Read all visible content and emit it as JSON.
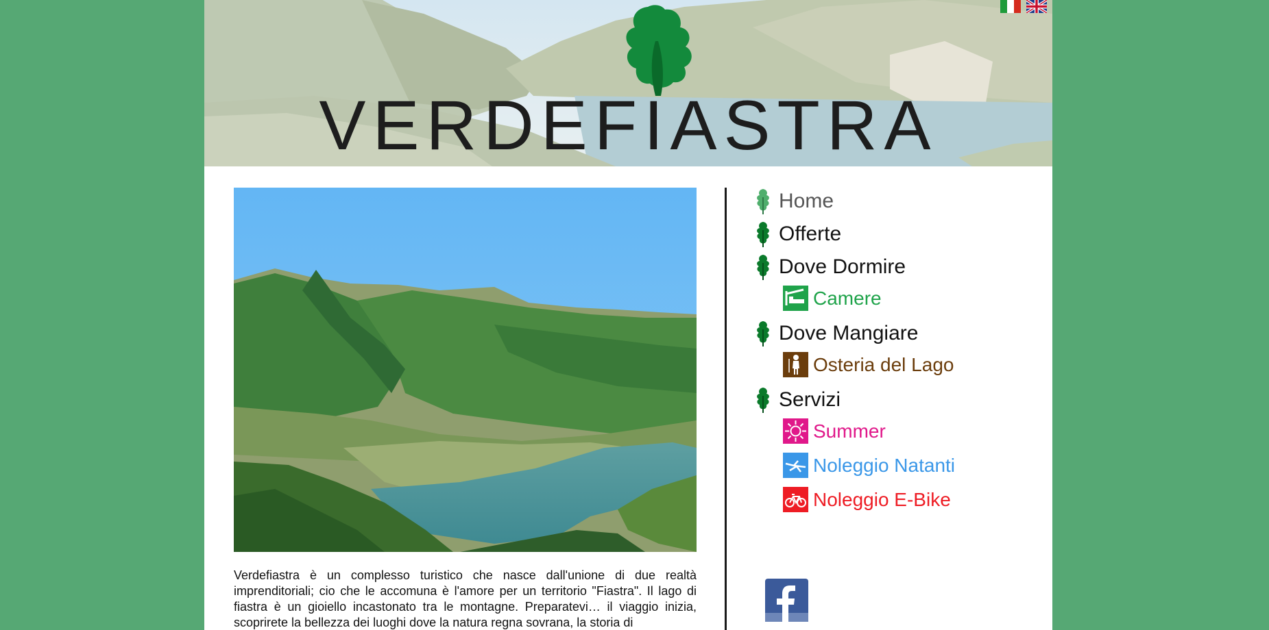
{
  "site": {
    "logo_text": "VERDEFIASTRA",
    "languages": [
      {
        "code": "it",
        "icon": "italian-flag-icon"
      },
      {
        "code": "en",
        "icon": "uk-flag-icon"
      }
    ]
  },
  "nav": {
    "items": [
      {
        "label": "Home",
        "icon": "oak-leaf-icon"
      },
      {
        "label": "Offerte",
        "icon": "oak-leaf-icon"
      },
      {
        "label": "Dove Dormire",
        "icon": "oak-leaf-icon"
      },
      {
        "label": "Dove Mangiare",
        "icon": "oak-leaf-icon"
      },
      {
        "label": "Servizi",
        "icon": "oak-leaf-icon"
      }
    ],
    "sub_items": {
      "camere": {
        "label": "Camere",
        "icon": "bed-icon",
        "color": "#1fa34a"
      },
      "osteria": {
        "label": "Osteria del Lago",
        "icon": "chef-icon",
        "color": "#6b3d0c"
      },
      "summer": {
        "label": "Summer",
        "icon": "sun-icon",
        "color": "#e0188a"
      },
      "natanti": {
        "label": "Noleggio Natanti",
        "icon": "boat-icon",
        "color": "#3a97e8"
      },
      "ebike": {
        "label": "Noleggio E-Bike",
        "icon": "bicycle-icon",
        "color": "#ee1c24"
      }
    }
  },
  "main": {
    "intro_text": "Verdefiastra è un complesso turistico che nasce dall'unione di due realtà imprenditoriali; cio che le accomuna è l'amore per un territorio \"Fiastra\". Il lago di fiastra è un gioiello incastonato tra le montagne. Preparatevi… il viaggio inizia, scoprirete la bellezza dei luoghi dove la natura regna sovrana, la storia di"
  },
  "social": {
    "facebook_icon": "facebook-icon"
  },
  "colors": {
    "background": "#56a874",
    "leaf_green": "#0b7a2b",
    "home_leaf": "#4fae6c"
  }
}
